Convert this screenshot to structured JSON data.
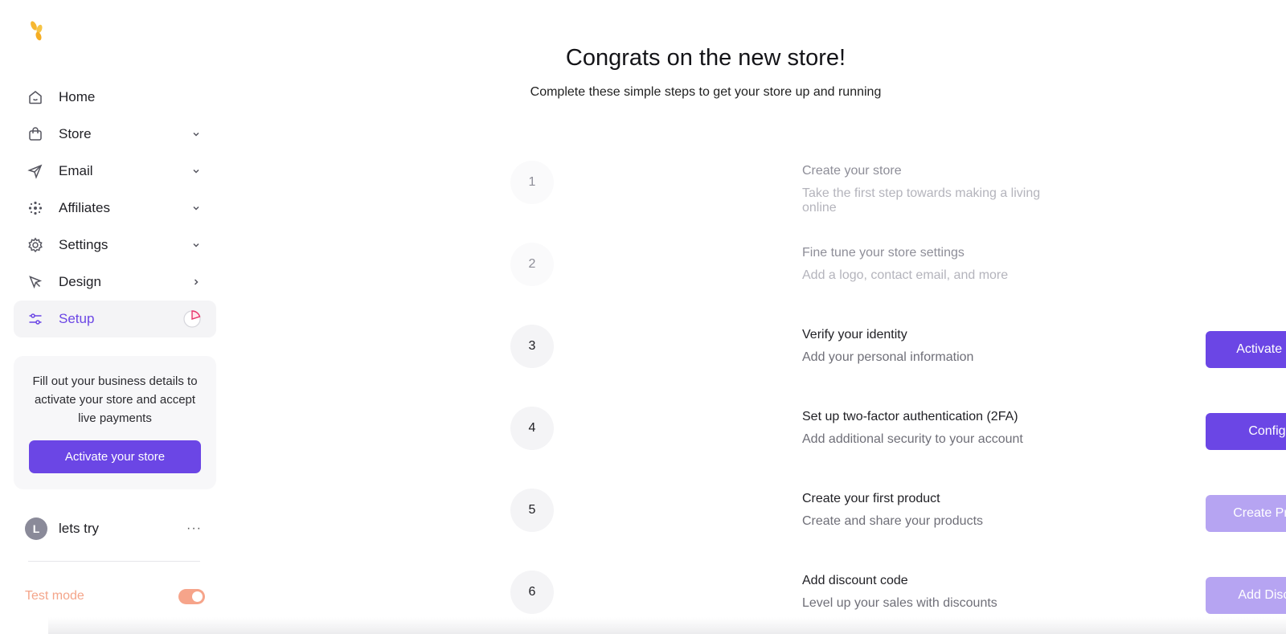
{
  "colors": {
    "accent": "#6b46e5",
    "accent_muted": "#b6a4f2",
    "success": "#22c268",
    "test_mode": "#f6a48a"
  },
  "sidebar": {
    "logo_icon": "flower-logo-icon",
    "items": [
      {
        "label": "Home",
        "icon": "home-icon",
        "chevron": "none"
      },
      {
        "label": "Store",
        "icon": "bag-icon",
        "chevron": "down"
      },
      {
        "label": "Email",
        "icon": "send-icon",
        "chevron": "down"
      },
      {
        "label": "Affiliates",
        "icon": "affiliates-icon",
        "chevron": "down"
      },
      {
        "label": "Settings",
        "icon": "gear-icon",
        "chevron": "down"
      },
      {
        "label": "Design",
        "icon": "cursor-icon",
        "chevron": "right"
      },
      {
        "label": "Setup",
        "icon": "sliders-icon",
        "chevron": "progress",
        "active": true
      }
    ],
    "promo": {
      "text": "Fill out your business details to activate your store and accept live payments",
      "button": "Activate your store"
    },
    "user": {
      "initial": "L",
      "name": "lets try",
      "menu": "···"
    },
    "test_mode": {
      "label": "Test mode",
      "enabled": true
    }
  },
  "main": {
    "title": "Congrats on the new store!",
    "subtitle": "Complete these simple steps to get your store up and running",
    "steps": [
      {
        "num": "1",
        "title": "Create your store",
        "desc": "Take the first step towards making a living online",
        "status": "done"
      },
      {
        "num": "2",
        "title": "Fine tune your store settings",
        "desc": "Add a logo, contact email, and more",
        "status": "done"
      },
      {
        "num": "3",
        "title": "Verify your identity",
        "desc": "Add your personal information",
        "action": "Activate Store"
      },
      {
        "num": "4",
        "title": "Set up two-factor authentication (2FA)",
        "desc": "Add additional security to your account",
        "action": "Configure"
      },
      {
        "num": "5",
        "title": "Create your first product",
        "desc": "Create and share your products",
        "action": "Create Product",
        "muted": true
      },
      {
        "num": "6",
        "title": "Add discount code",
        "desc": "Level up your sales with discounts",
        "action": "Add Discount",
        "muted": true
      }
    ]
  }
}
